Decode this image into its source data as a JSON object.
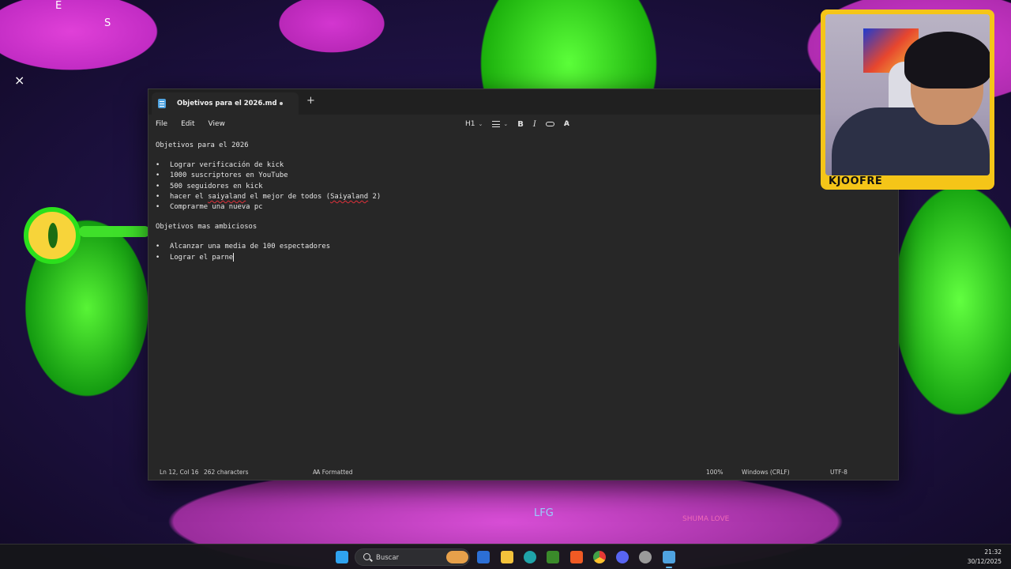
{
  "wallpaper": {
    "texts": [
      "E",
      "S",
      "LFG",
      "SHUMA LOVE"
    ]
  },
  "notepad": {
    "tab_title": "Objetivos para el 2026.md",
    "menu": [
      "File",
      "Edit",
      "View"
    ],
    "toolbar": {
      "heading": "H1",
      "bold": "B",
      "italic": "I"
    },
    "document": {
      "heading1": "Objetivos para el 2026",
      "list1": [
        "Lograr verificación de kick",
        "1000 suscriptores en YouTube",
        "500 seguidores en kick",
        "hacer el saiyaland el mejor de todos (Saiyaland 2)",
        "Comprarme una nueva pc"
      ],
      "list1_item4_parts": [
        "hacer el ",
        "saiyaland",
        " el mejor de todos (",
        "Saiyaland",
        " 2)"
      ],
      "heading2": "Objetivos mas ambiciosos",
      "list2": [
        "Alcanzar una media de 100 espectadores",
        "Lograr el parne"
      ]
    },
    "status": {
      "position": "Ln 12, Col 16",
      "characters": "262 characters",
      "format": "Formatted",
      "zoom": "100%",
      "line_endings": "Windows (CRLF)",
      "encoding": "UTF-8"
    }
  },
  "webcam": {
    "label": "KJOOFRE"
  },
  "taskbar": {
    "search_label": "Buscar",
    "time": "21:32",
    "date": "30/12/2025",
    "apps": [
      "windows-start",
      "burger-widget",
      "notepad-blue",
      "file-explorer",
      "edge",
      "minecraft",
      "brave",
      "chrome",
      "discord",
      "steam-like",
      "notepad"
    ]
  },
  "colors": {
    "accent_yellow": "#f5c518",
    "spell_error": "#e0303a",
    "window_bg": "#272727"
  }
}
